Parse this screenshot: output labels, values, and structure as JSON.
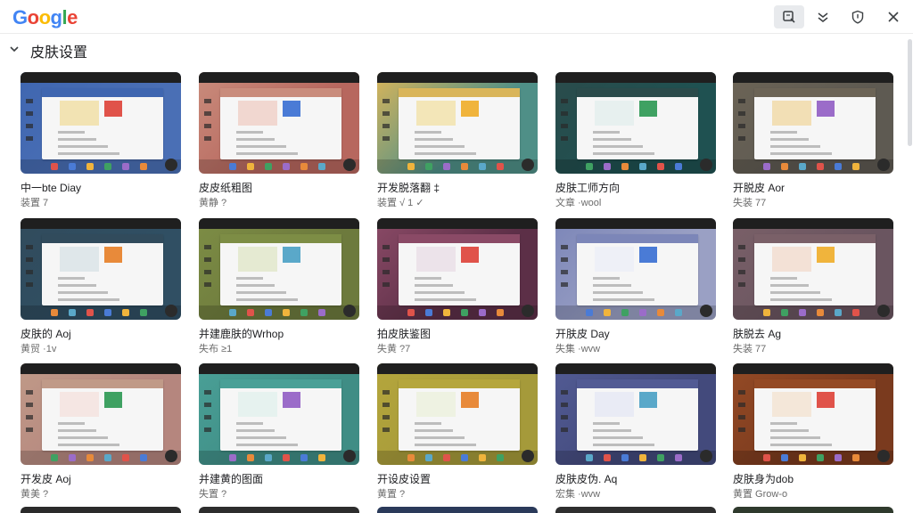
{
  "header": {
    "logo_letters": [
      {
        "ch": "G",
        "color": "#4285F4"
      },
      {
        "ch": "o",
        "color": "#EA4335"
      },
      {
        "ch": "o",
        "color": "#FBBC05"
      },
      {
        "ch": "g",
        "color": "#4285F4"
      },
      {
        "ch": "l",
        "color": "#34A853"
      },
      {
        "ch": "e",
        "color": "#EA4335"
      }
    ],
    "buttons": [
      "search-box-icon",
      "collapse-icon",
      "shield-icon",
      "close-icon"
    ]
  },
  "section": {
    "title": "皮肤设置"
  },
  "skins": [
    {
      "title": "中一bte Diay",
      "sub": "装置 7",
      "bg": "#4a6fb5",
      "accent": "#f2e3b3",
      "top": "#3f66b0"
    },
    {
      "title": "皮皮纸粗图",
      "sub": "黄静 ?",
      "bg": "#b7675e",
      "accent": "#f1d7d0",
      "top": "#c98c7c"
    },
    {
      "title": "开发脱落翻 ‡",
      "sub": "装置 √ 1 ✓",
      "bg": "#4f8f87",
      "accent": "#f3e6b8",
      "top": "#d9b55a"
    },
    {
      "title": "皮肤工师方向",
      "sub": "文章 ·wool",
      "bg": "#1f5151",
      "accent": "#e7f0ef",
      "top": "#2b4b4b"
    },
    {
      "title": "开脱皮 Aor",
      "sub": "失装 77",
      "bg": "#5e5a52",
      "accent": "#f2dfb5",
      "top": "#6c6456"
    },
    {
      "title": "皮肤的 Aoj",
      "sub": "黄贸 ·1v",
      "bg": "#304f63",
      "accent": "#dfe7ea",
      "top": "#314b5c"
    },
    {
      "title": "并建鹿肤的Wrhop",
      "sub": "失布 ≥1",
      "bg": "#6d7a3d",
      "accent": "#e5ead2",
      "top": "#7d8d45"
    },
    {
      "title": "拍皮肤鉴图",
      "sub": "失黄 ?7",
      "bg": "#5c2f47",
      "accent": "#ece3ea",
      "top": "#8a4a66"
    },
    {
      "title": "开肤皮 Day",
      "sub": "失集 ·wvw",
      "bg": "#9aa0c4",
      "accent": "#eef0f7",
      "top": "#7c86b8"
    },
    {
      "title": "肤脱去 Ag",
      "sub": "失装 77",
      "bg": "#6a5560",
      "accent": "#f3e1d6",
      "top": "#7a6068"
    },
    {
      "title": "开发皮 Aoj",
      "sub": "黄美 ?",
      "bg": "#b5867e",
      "accent": "#f5e6e3",
      "top": "#c09a88"
    },
    {
      "title": "并建黄的图面",
      "sub": "失置 ?",
      "bg": "#3f8d85",
      "accent": "#e6f2ef",
      "top": "#4aa097"
    },
    {
      "title": "开设皮设置",
      "sub": "黄置 ?",
      "bg": "#a59a3a",
      "accent": "#eef2e2",
      "top": "#b5a63c"
    },
    {
      "title": "皮肤皮伪. Aq",
      "sub": "宏集 ·wvw",
      "bg": "#434a7c",
      "accent": "#e9ebf5",
      "top": "#525b94"
    },
    {
      "title": "皮肤身为dob",
      "sub": "黄置 Grow-o",
      "bg": "#7a3a1e",
      "accent": "#f4e7d9",
      "top": "#944a25"
    }
  ],
  "peek_colors": [
    "#2a2a2a",
    "#2d2d2d",
    "#2a3a5a",
    "#2e2e2e",
    "#2f3a2d"
  ]
}
